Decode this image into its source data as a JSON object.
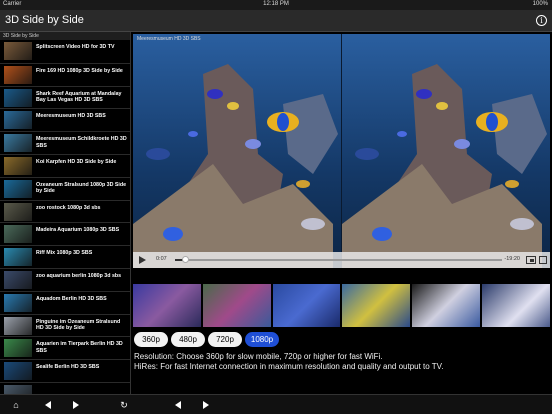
{
  "status": {
    "carrier": "Carrier",
    "time": "12:18 PM",
    "battery": "100%"
  },
  "nav": {
    "title": "3D Side by Side",
    "info_icon": "info-icon"
  },
  "sidebar": {
    "header": "3D Side by Side",
    "items": [
      {
        "label": "Splitscreen Video HD for 3D TV",
        "color": "#7a5a3a"
      },
      {
        "label": "Fire 169 HD 1080p 3D Side by Side",
        "color": "#b0501a"
      },
      {
        "label": "Shark Reef Aquarium at Mandalay Bay Las Vegas HD 3D SBS",
        "color": "#1a5a8a"
      },
      {
        "label": "Meeresmuseum HD 3D SBS",
        "color": "#2a6a9a"
      },
      {
        "label": "Meeresmuseum Schildkroete HD 3D SBS",
        "color": "#3a7aa0"
      },
      {
        "label": "Koi Karpfen HD 3D Side by Side",
        "color": "#8a6a2a"
      },
      {
        "label": "Ozeaneum Stralsund 1080p 3D Side by Side",
        "color": "#1a6a9a"
      },
      {
        "label": "zoo rostock 1080p 3d sbs",
        "color": "#5a5a4a"
      },
      {
        "label": "Madeira Aquarium 1080p 3D SBS",
        "color": "#4a6a5a"
      },
      {
        "label": "Riff Mix 1080p 3D SBS",
        "color": "#2a8ab0"
      },
      {
        "label": "zoo aquarium berlin 1080p 3d sbs",
        "color": "#3a4a6a"
      },
      {
        "label": "Aquadom Berlin HD 3D SBS",
        "color": "#2a7ab0"
      },
      {
        "label": "Pinguine im Ozeaneum Stralsund HD 3D Side by Side",
        "color": "#9aa0aa"
      },
      {
        "label": "Aquarien im Tierpark Berlin HD 3D SBS",
        "color": "#3a8a4a"
      },
      {
        "label": "Sealife Berlin HD 3D SBS",
        "color": "#1a4a7a"
      },
      {
        "label": "",
        "color": "#4a5a6a"
      }
    ]
  },
  "video": {
    "title": "Meeresmuseum HD 3D SBS",
    "elapsed": "0:07",
    "remaining": "-19:20",
    "progress": 0.03
  },
  "resolutions": [
    {
      "label": "360p",
      "active": false
    },
    {
      "label": "480p",
      "active": false
    },
    {
      "label": "720p",
      "active": false
    },
    {
      "label": "1080p",
      "active": true
    }
  ],
  "help": {
    "line1": "Resolution: Choose 360p for slow mobile, 720p or higher for fast WiFi.",
    "line2": "HiRes: For fast Internet connection in maximum resolution and quality and output to TV."
  },
  "toolbar": {
    "home_icon": "home-icon",
    "back_icon": "back-icon",
    "forward_icon": "forward-icon",
    "reload_icon": "reload-icon",
    "prev_icon": "previous-icon",
    "next_icon": "next-icon"
  },
  "colors": {
    "accent": "#1f4fd6",
    "water": "#1a3d6c"
  }
}
